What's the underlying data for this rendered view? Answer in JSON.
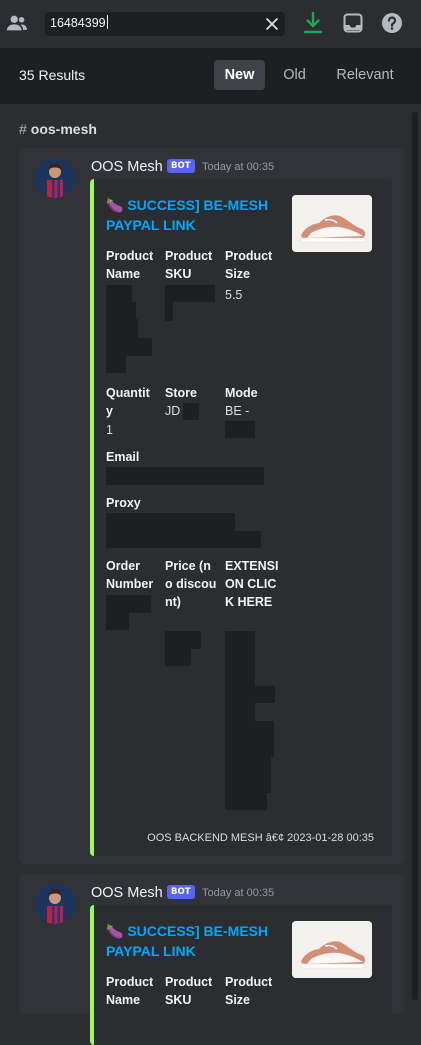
{
  "topbar": {
    "search_value": "16484399",
    "icons": [
      "people-icon",
      "clear-icon",
      "download-icon",
      "inbox-icon",
      "help-icon"
    ],
    "download_color": "#23a559"
  },
  "results_header": {
    "count": "35 Results",
    "tabs": [
      {
        "label": "New",
        "active": true
      },
      {
        "label": "Old",
        "active": false
      },
      {
        "label": "Relevant",
        "active": false
      }
    ]
  },
  "channel": {
    "hash": "#",
    "name": "oos-mesh"
  },
  "messages": [
    {
      "author": "OOS Mesh",
      "badge": "BOT",
      "time": "Today at 00:35",
      "embed": {
        "accent_color": "#9cfc52",
        "title": "🍆 SUCCESS] BE-MESH PAYPAL LINK",
        "fields": {
          "product_name": "Product Name",
          "product_sku": "Product SKU",
          "product_size": "Product Size",
          "product_size_value": "5.5",
          "quantity": "Quantity",
          "quantity_value": "1",
          "store": "Store",
          "store_value": "JD",
          "mode": "Mode",
          "mode_value": "BE -",
          "email": "Email",
          "proxy": "Proxy",
          "order_number": "Order Number",
          "price": "Price (no discount)",
          "extension": "EXTENSION CLICK HERE"
        },
        "footer": "OOS BACKEND MESH â€¢ 2023-01-28 00:35"
      }
    },
    {
      "author": "OOS Mesh",
      "badge": "BOT",
      "time": "Today at 00:35",
      "embed": {
        "accent_color": "#9cfc52",
        "title": "🍆 SUCCESS] BE-MESH PAYPAL LINK",
        "fields": {
          "product_name": "Product Name",
          "product_sku": "Product SKU",
          "product_size": "Product Size"
        }
      }
    }
  ]
}
